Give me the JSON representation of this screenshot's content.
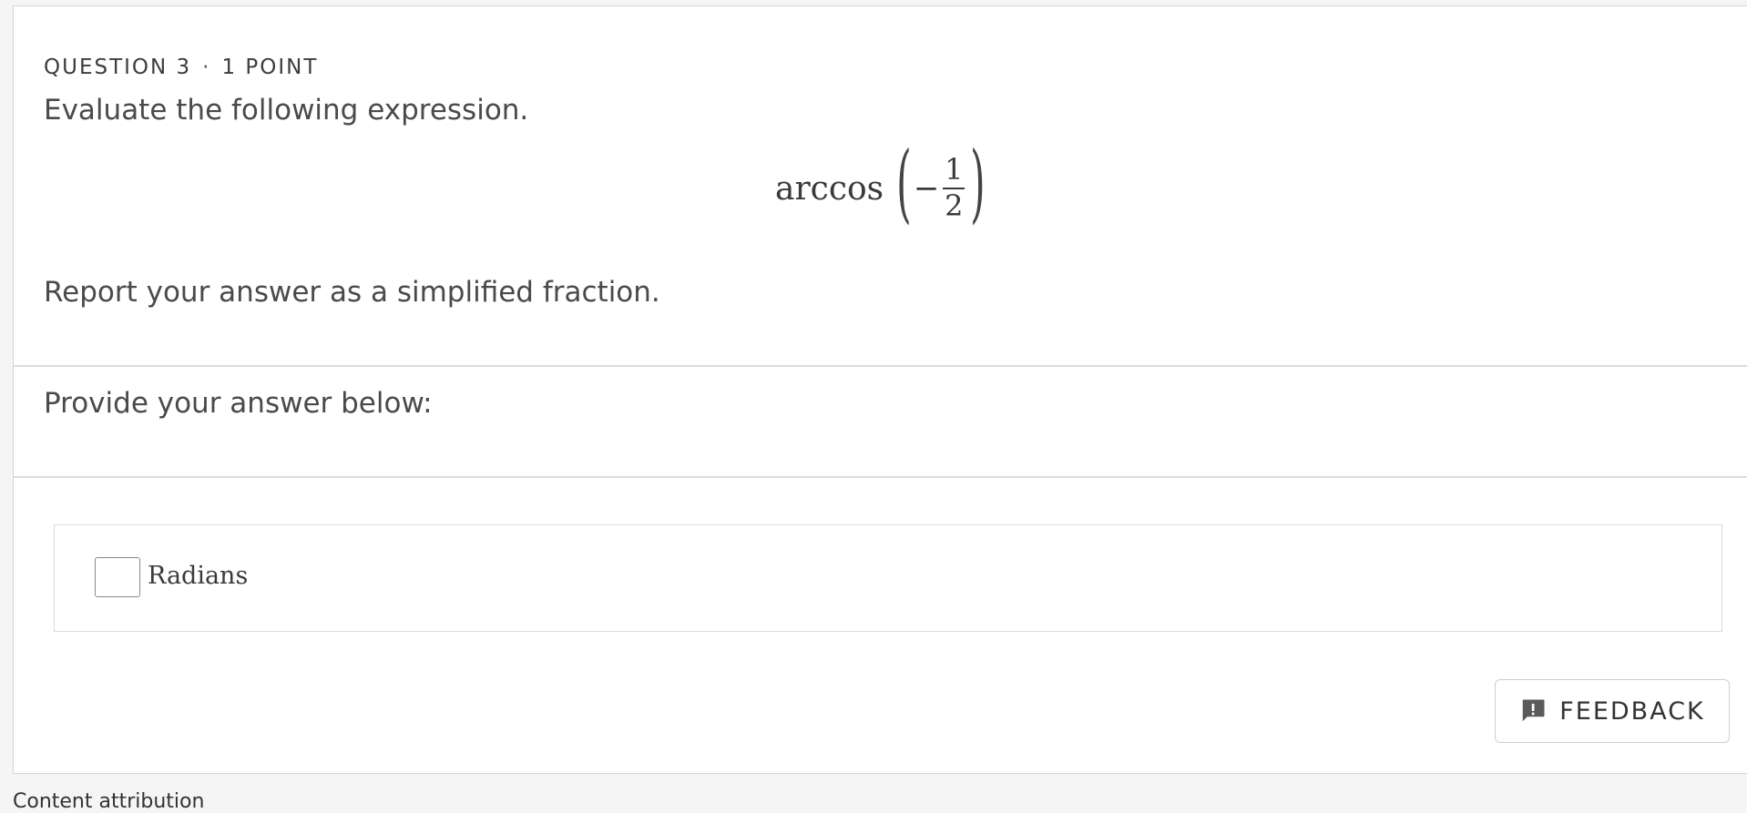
{
  "question": {
    "number_label": "QUESTION 3",
    "separator": "·",
    "points_label": "1 POINT",
    "prompt": "Evaluate the following expression.",
    "expression": {
      "function": "arccos",
      "open_paren": "(",
      "sign": "−",
      "numerator": "1",
      "denominator": "2",
      "close_paren": ")"
    },
    "instruction": "Report your answer as a simplified fraction."
  },
  "answer": {
    "heading": "Provide your answer below:",
    "input_value": "",
    "unit_label": "Radians"
  },
  "feedback_button": {
    "label": "FEEDBACK",
    "icon": "feedback-message-icon"
  },
  "footer": {
    "partial_text": "Content attribution"
  }
}
